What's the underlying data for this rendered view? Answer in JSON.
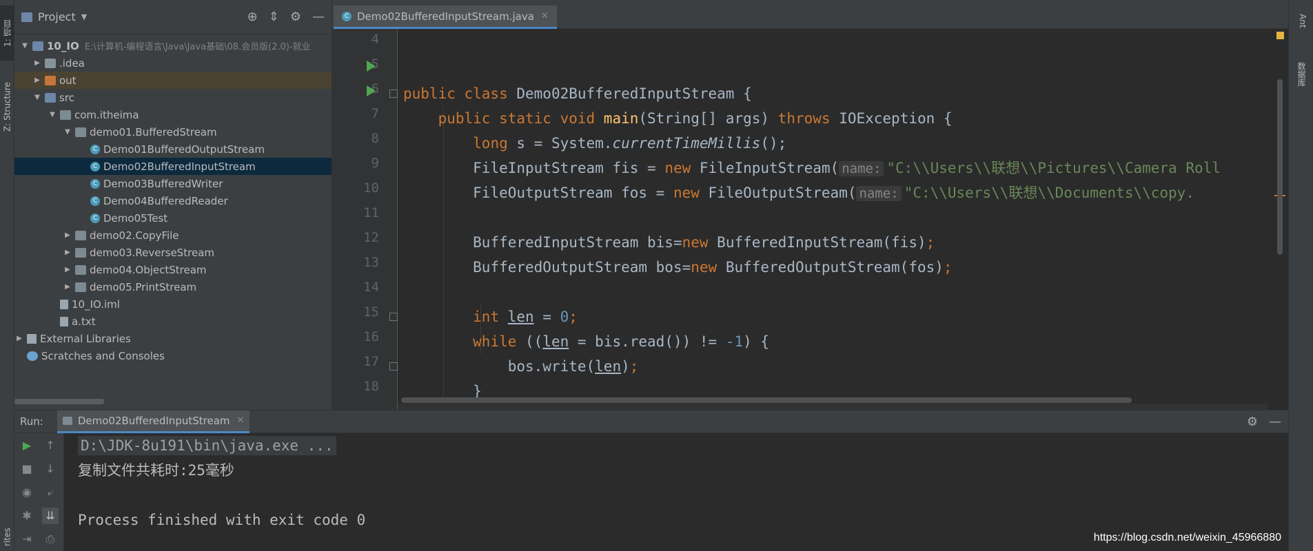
{
  "sidebar": {
    "left_tabs": [
      "1: 项目",
      "Z: Structure",
      "rites"
    ],
    "right_tabs": [
      "Ant",
      "数据库"
    ]
  },
  "project": {
    "title": "Project",
    "tree": [
      {
        "label": "10_IO",
        "path": "E:\\计算机-编程语言\\Java\\Java基础\\08.会员版(2.0)-就业"
      },
      {
        "label": ".idea"
      },
      {
        "label": "out"
      },
      {
        "label": "src"
      },
      {
        "label": "com.itheima"
      },
      {
        "label": "demo01.BufferedStream"
      },
      {
        "label": "Demo01BufferedOutputStream"
      },
      {
        "label": "Demo02BufferedInputStream"
      },
      {
        "label": "Demo03BufferedWriter"
      },
      {
        "label": "Demo04BufferedReader"
      },
      {
        "label": "Demo05Test"
      },
      {
        "label": "demo02.CopyFile"
      },
      {
        "label": "demo03.ReverseStream"
      },
      {
        "label": "demo04.ObjectStream"
      },
      {
        "label": "demo05.PrintStream"
      },
      {
        "label": "10_IO.iml"
      },
      {
        "label": "a.txt"
      },
      {
        "label": "External Libraries"
      },
      {
        "label": "Scratches and Consoles"
      }
    ]
  },
  "editor": {
    "tab_title": "Demo02BufferedInputStream.java",
    "line_numbers": [
      "4",
      "5",
      "6",
      "7",
      "8",
      "9",
      "10",
      "11",
      "12",
      "13",
      "14",
      "15",
      "16",
      "17",
      "18"
    ],
    "code": {
      "l5_kw": "public class ",
      "l5_rest": "Demo02BufferedInputStream {",
      "l6_kw1": "public static void ",
      "l6_fn": "main",
      "l6_mid": "(String[] args) ",
      "l6_kw2": "throws ",
      "l6_rest": "IOException {",
      "l7_kw": "long ",
      "l7_a": "s = System.",
      "l7_it": "currentTimeMillis",
      "l7_b": "();",
      "l8_a": "FileInputStream fis = ",
      "l8_kw": "new ",
      "l8_b": "FileInputStream(",
      "l8_hint": "name:",
      "l8_str": "\"C:\\\\Users\\\\联想\\\\Pictures\\\\Camera Roll",
      "l9_a": "FileOutputStream fos = ",
      "l9_kw": "new ",
      "l9_b": "FileOutputStream(",
      "l9_hint": "name:",
      "l9_str": "\"C:\\\\Users\\\\联想\\\\Documents\\\\copy.",
      "l11_a": "BufferedInputStream bis=",
      "l11_kw": "new ",
      "l11_b": "BufferedInputStream(fis)",
      "l11_semi": ";",
      "l12_a": "BufferedOutputStream bos=",
      "l12_kw": "new ",
      "l12_b": "BufferedOutputStream(fos)",
      "l12_semi": ";",
      "l14_kw": "int ",
      "l14_var": "len",
      "l14_b": " = ",
      "l14_num": "0",
      "l14_semi": ";",
      "l15_kw": "while ",
      "l15_a": "((",
      "l15_var": "len",
      "l15_b": " = bis.read()) != ",
      "l15_num": "-1",
      "l15_c": ") {",
      "l16_a": "bos.write(",
      "l16_var": "len",
      "l16_b": ")",
      "l16_semi": ";",
      "l17": "}"
    }
  },
  "run": {
    "label": "Run:",
    "tab_title": "Demo02BufferedInputStream",
    "console": [
      "D:\\JDK-8u191\\bin\\java.exe ...",
      "复制文件共耗时:25毫秒",
      "",
      "Process finished with exit code 0"
    ]
  },
  "watermark": "https://blog.csdn.net/weixin_45966880",
  "colors": {
    "background": "#2b2b2b",
    "panel": "#3c3f41",
    "keyword": "#cc7832",
    "function": "#ffc66d",
    "string": "#6a8759",
    "number": "#6897bb",
    "selection": "#0d293e",
    "run_arrow": "#4fa751"
  }
}
